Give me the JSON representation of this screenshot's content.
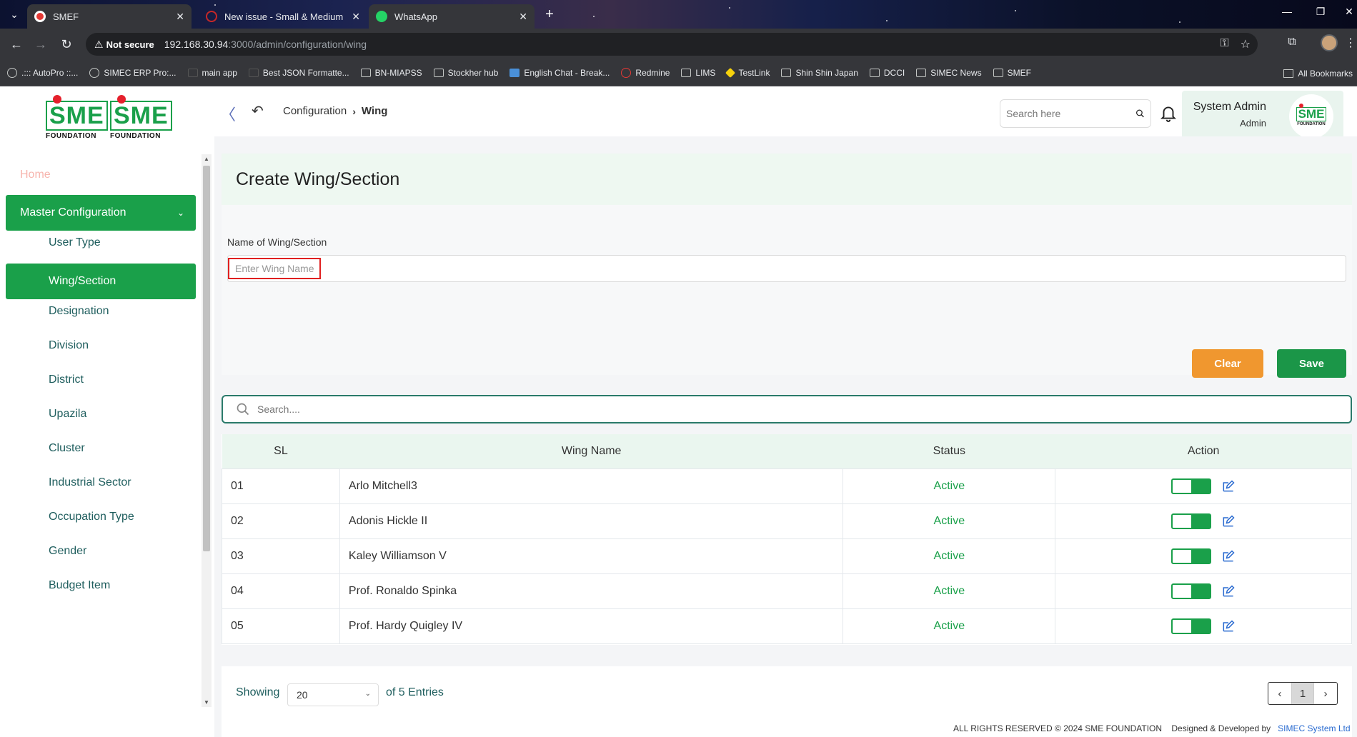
{
  "browser": {
    "tabs": [
      {
        "title": "SMEF",
        "active": true
      },
      {
        "title": "New issue - Small & Medium En",
        "active": false
      },
      {
        "title": "WhatsApp",
        "active": true
      }
    ],
    "security_label": "Not secure",
    "url_host": "192.168.30.94",
    "url_path": ":3000/admin/configuration/wing",
    "bookmarks": [
      ".::: AutoPro ::...",
      "SIMEC ERP Pro:...",
      "main app",
      "Best JSON Formatte...",
      "BN-MIAPSS",
      "Stockher hub",
      "English Chat - Break...",
      "Redmine",
      "LIMS",
      "TestLink",
      "Shin Shin Japan",
      "DCCI",
      "SIMEC News",
      "SMEF"
    ],
    "all_bookmarks": "All Bookmarks"
  },
  "logo": {
    "letters": "SME",
    "sub": "FOUNDATION"
  },
  "header": {
    "breadcrumb_parent": "Configuration",
    "breadcrumb_current": "Wing",
    "search_placeholder": "Search here",
    "user_name": "System Admin",
    "user_role": "Admin"
  },
  "sidebar": {
    "home": "Home",
    "section": "Master Configuration",
    "items": [
      "User Type",
      "Wing/Section",
      "Designation",
      "Division",
      "District",
      "Upazila",
      "Cluster",
      "Industrial Sector",
      "Occupation Type",
      "Gender",
      "Budget Item"
    ],
    "active_item": "Wing/Section"
  },
  "form": {
    "title": "Create Wing/Section",
    "field_label": "Name of Wing/Section",
    "field_placeholder": "Enter Wing Name",
    "clear_label": "Clear",
    "save_label": "Save"
  },
  "list": {
    "search_placeholder": "Search....",
    "columns": [
      "SL",
      "Wing Name",
      "Status",
      "Action"
    ],
    "rows": [
      {
        "sl": "01",
        "name": "Arlo Mitchell3",
        "status": "Active"
      },
      {
        "sl": "02",
        "name": "Adonis Hickle II",
        "status": "Active"
      },
      {
        "sl": "03",
        "name": "Kaley Williamson V",
        "status": "Active"
      },
      {
        "sl": "04",
        "name": "Prof. Ronaldo Spinka",
        "status": "Active"
      },
      {
        "sl": "05",
        "name": "Prof. Hardy Quigley IV",
        "status": "Active"
      }
    ]
  },
  "pagination": {
    "showing_label": "Showing",
    "per_page": "20",
    "entries_label": "of 5 Entries",
    "current_page": "1"
  },
  "footer": {
    "copyright": "ALL RIGHTS RESERVED © 2024 SME FOUNDATION",
    "designed_by": "Designed & Developed by",
    "developer": "SIMEC System Ltd"
  },
  "colors": {
    "brand_green": "#1aa04a",
    "save_green": "#1b9648",
    "clear_orange": "#f0972f",
    "header_tint": "#eef8f1"
  }
}
